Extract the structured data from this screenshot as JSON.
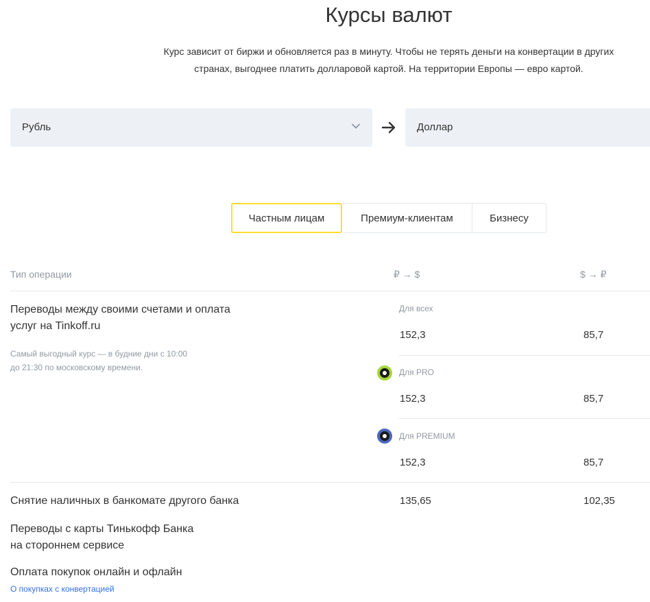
{
  "page": {
    "title": "Курсы валют",
    "subtitle_line1": "Курс зависит от биржи и обновляется раз в минуту. Чтобы не терять деньги на конвертации в других",
    "subtitle_line2": "странах, выгоднее платить долларовой картой. На территории Европы — евро картой."
  },
  "converter": {
    "from": "Рубль",
    "to": "Доллар",
    "from_icon": "chevron-down-icon",
    "direction_icon": "arrow-right-icon"
  },
  "tabs": [
    {
      "label": "Частным лицам",
      "active": true
    },
    {
      "label": "Премиум-клиентам",
      "active": false
    },
    {
      "label": "Бизнесу",
      "active": false
    }
  ],
  "table": {
    "headers": [
      "Тип операции",
      "₽ → $",
      "$ → ₽"
    ],
    "transfers": {
      "title_line1": "Переводы между своими счетами и оплата",
      "title_line2": "услуг на Tinkoff.ru",
      "note_line1": "Самый выгодный курс — в будние дни с 10:00",
      "note_line2": "до 21:30 по московскому времени.",
      "groups": [
        {
          "label": "Для всех",
          "buy": "152,3",
          "sell": "85,7"
        },
        {
          "label": "Для PRO",
          "buy": "152,3",
          "sell": "85,7",
          "badge_color": "#a5d63a"
        },
        {
          "label": "Для PREMIUM",
          "buy": "152,3",
          "sell": "85,7",
          "badge_color": "#4a68b8"
        }
      ]
    },
    "cash": {
      "title": "Снятие наличных в банкомате другого банка",
      "buy": "135,65",
      "sell": "102,35"
    },
    "third_party": {
      "title_line1": "Переводы с карты Тинькофф Банка",
      "title_line2": "на стороннем сервисе"
    },
    "purchases": {
      "title": "Оплата покупок онлайн и офлайн",
      "link": "О покупках с конвертацией"
    }
  },
  "colors": {
    "accent": "#ffdd2d",
    "selector_bg": "#edf1f6",
    "muted": "#9299a2",
    "link": "#336fee"
  }
}
